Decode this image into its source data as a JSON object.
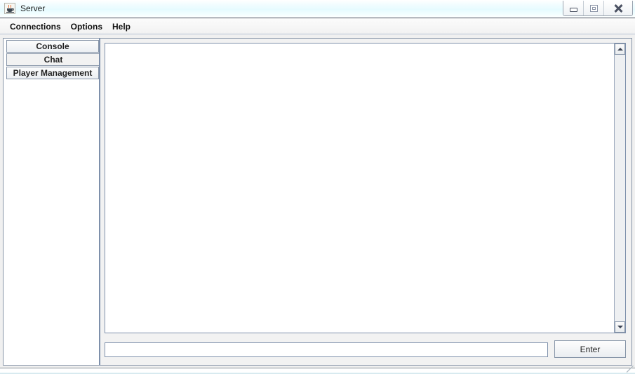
{
  "window": {
    "title": "Server",
    "app_icon": "java-coffee-cup-icon",
    "controls": {
      "minimize": "minimize-icon",
      "maximize": "maximize-icon",
      "close": "close-icon"
    }
  },
  "menubar": {
    "items": [
      {
        "label": "Connections"
      },
      {
        "label": "Options"
      },
      {
        "label": "Help"
      }
    ]
  },
  "tabs": {
    "orientation": "left",
    "selected_index": 1,
    "items": [
      {
        "label": "Console",
        "selected": false
      },
      {
        "label": "Chat",
        "selected": true
      },
      {
        "label": "Player Management",
        "selected": false
      }
    ]
  },
  "chat_panel": {
    "log": {
      "text": "",
      "scrollbar": {
        "up_arrow": "scroll-up-icon",
        "down_arrow": "scroll-down-icon",
        "thumb_visible": false
      }
    },
    "input": {
      "value": "",
      "placeholder": ""
    },
    "send_button": {
      "label": "Enter"
    }
  },
  "colors": {
    "titlebar_tint": "#e6fbff",
    "border": "#8795a8",
    "panel_bg": "#f2f2f2",
    "field_bg": "#ffffff",
    "text": "#1a1a1a"
  }
}
